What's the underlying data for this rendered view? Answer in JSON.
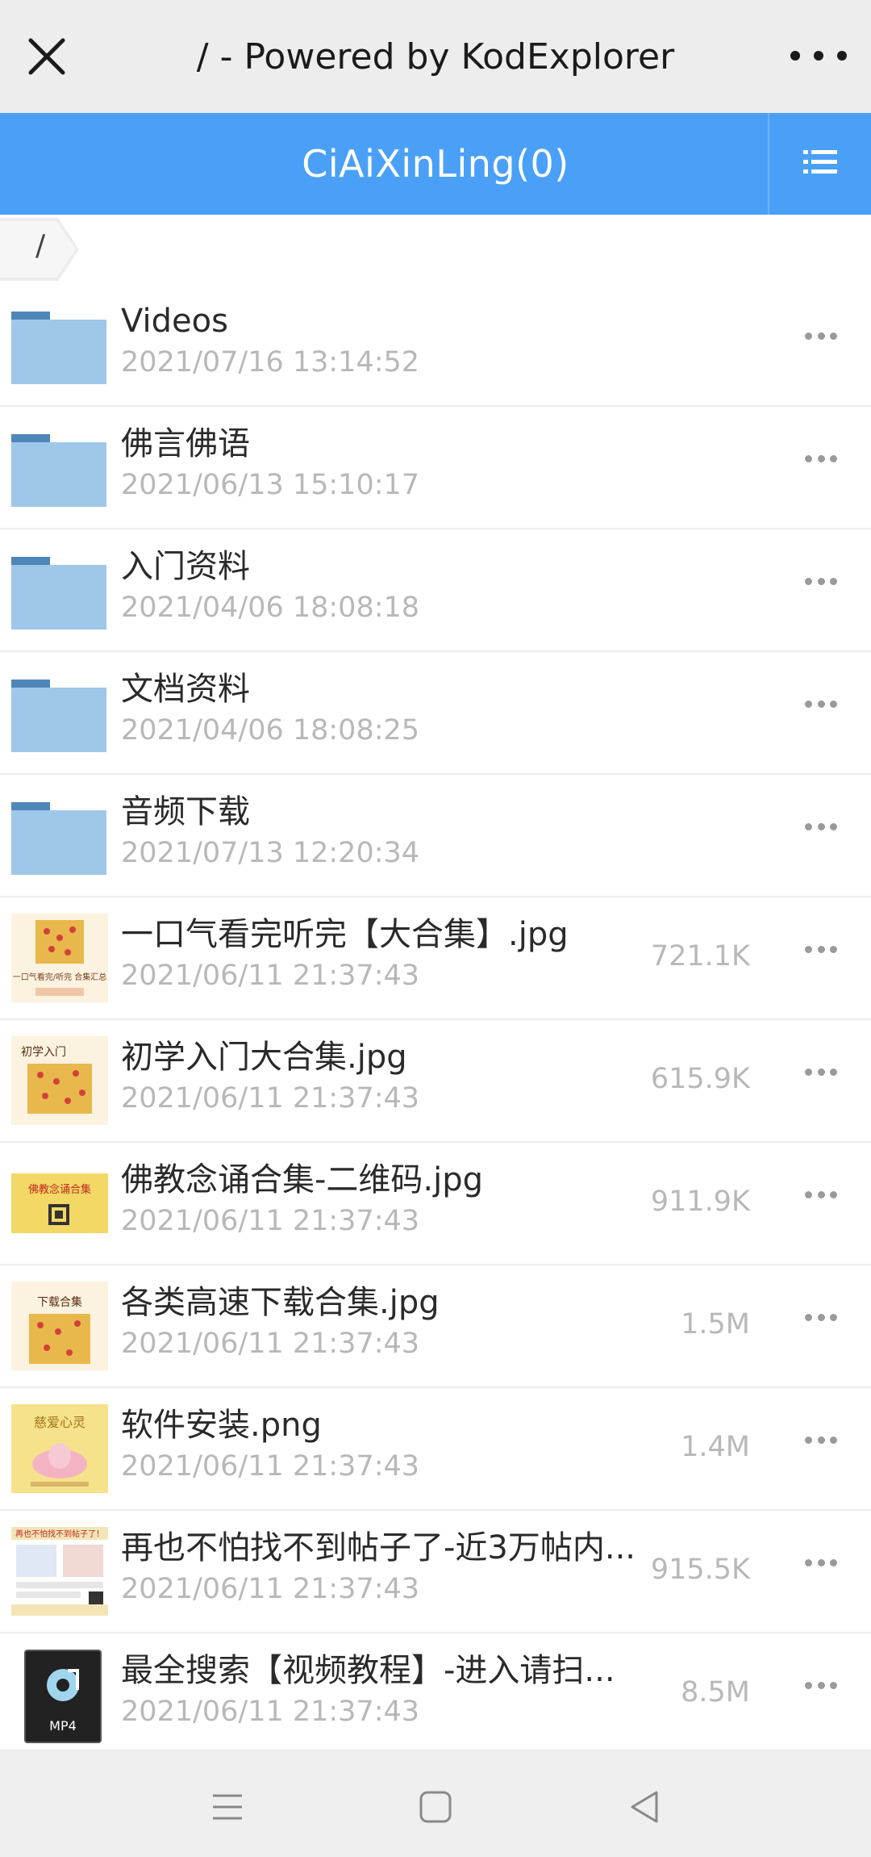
{
  "browser": {
    "title": "/ - Powered by KodExplorer",
    "close_icon": "close-icon",
    "more_icon": "more-horizontal-icon"
  },
  "header": {
    "title": "CiAiXinLing(0)",
    "menu_icon": "list-icon",
    "accent_color": "#4aa0f7"
  },
  "breadcrumb": {
    "path": "/"
  },
  "files": [
    {
      "name": "Videos",
      "date": "2021/07/16 13:14:52",
      "size": "",
      "type": "folder"
    },
    {
      "name": "佛言佛语",
      "date": "2021/06/13 15:10:17",
      "size": "",
      "type": "folder"
    },
    {
      "name": "入门资料",
      "date": "2021/04/06 18:08:18",
      "size": "",
      "type": "folder"
    },
    {
      "name": "文档资料",
      "date": "2021/04/06 18:08:25",
      "size": "",
      "type": "folder"
    },
    {
      "name": "音频下载",
      "date": "2021/07/13 12:20:34",
      "size": "",
      "type": "folder"
    },
    {
      "name": "一口气看完听完【大合集】.jpg",
      "date": "2021/06/11 21:37:43",
      "size": "721.1K",
      "type": "image"
    },
    {
      "name": "初学入门大合集.jpg",
      "date": "2021/06/11 21:37:43",
      "size": "615.9K",
      "type": "image"
    },
    {
      "name": "佛教念诵合集-二维码.jpg",
      "date": "2021/06/11 21:37:43",
      "size": "911.9K",
      "type": "image"
    },
    {
      "name": "各类高速下载合集.jpg",
      "date": "2021/06/11 21:37:43",
      "size": "1.5M",
      "type": "image"
    },
    {
      "name": "软件安装.png",
      "date": "2021/06/11 21:37:43",
      "size": "1.4M",
      "type": "image"
    },
    {
      "name": "再也不怕找不到帖子了-近3万帖内...",
      "date": "2021/06/11 21:37:43",
      "size": "915.5K",
      "type": "image"
    },
    {
      "name": "最全搜索【视频教程】-进入请扫...",
      "date": "2021/06/11 21:37:43",
      "size": "8.5M",
      "type": "video"
    }
  ],
  "thumb_text": {
    "img0": "一口气看完/听完 合集汇总",
    "img1": "初学入门",
    "img2": "佛教念诵合集",
    "img3": "下载合集",
    "img4": "慈爱心灵",
    "img5": "再也不怕找不到帖子了！",
    "mp4": "MP4"
  },
  "navigation": {
    "menu_icon": "menu-icon",
    "home_icon": "home-square-icon",
    "back_icon": "back-triangle-icon"
  }
}
